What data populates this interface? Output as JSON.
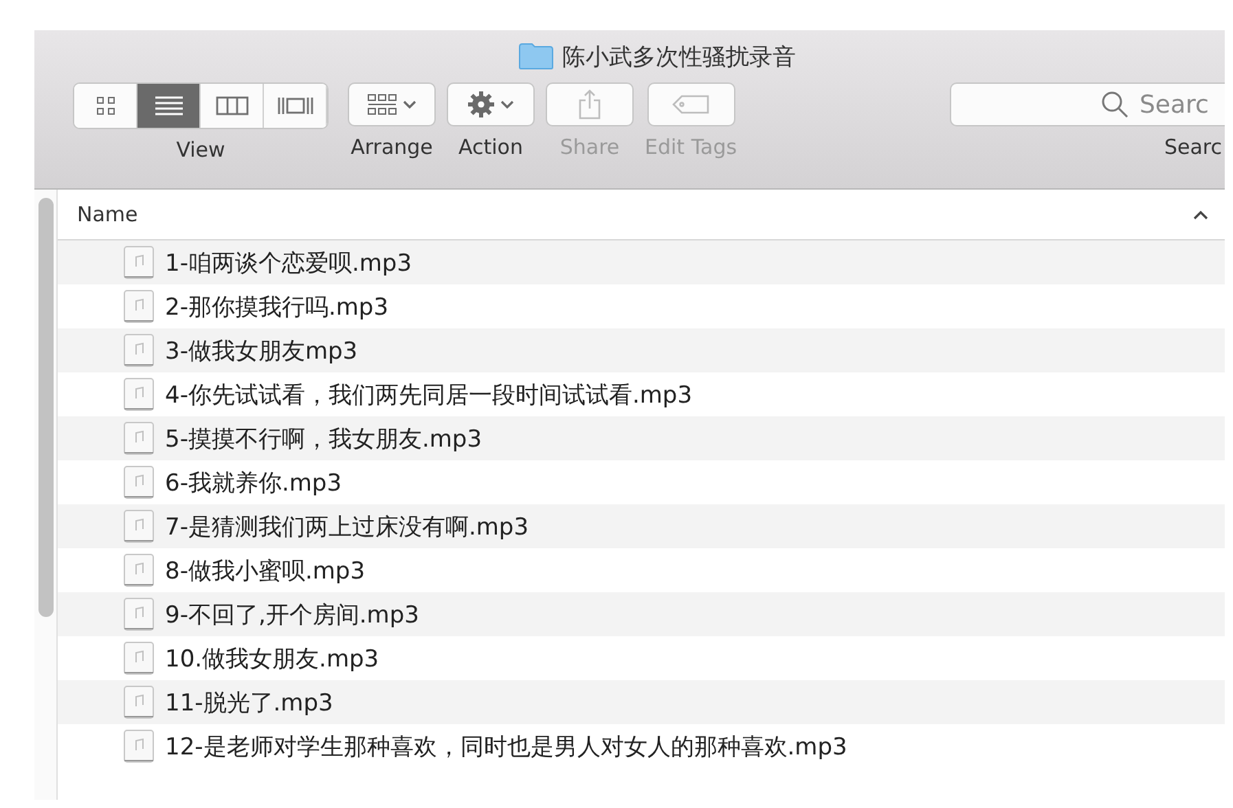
{
  "window": {
    "title": "陈小武多次性骚扰录音"
  },
  "toolbar": {
    "view_modes": [
      {
        "kind": "icon",
        "selected": false
      },
      {
        "kind": "list",
        "selected": true
      },
      {
        "kind": "columns",
        "selected": false
      },
      {
        "kind": "gallery",
        "selected": false
      }
    ],
    "view_label": "View",
    "items": [
      {
        "kind": "arrange",
        "label": "Arrange",
        "disabled": false
      },
      {
        "kind": "action",
        "label": "Action",
        "disabled": false
      },
      {
        "kind": "share",
        "label": "Share",
        "disabled": true
      },
      {
        "kind": "tags",
        "label": "Edit Tags",
        "disabled": true
      }
    ],
    "search": {
      "placeholder": "Searc",
      "label": "Searc"
    }
  },
  "list": {
    "header": "Name",
    "files": [
      {
        "name": "1-咱两谈个恋爱呗.mp3"
      },
      {
        "name": "2-那你摸我行吗.mp3"
      },
      {
        "name": "3-做我女朋友mp3"
      },
      {
        "name": "4-你先试试看，我们两先同居一段时间试试看.mp3"
      },
      {
        "name": "5-摸摸不行啊，我女朋友.mp3"
      },
      {
        "name": "6-我就养你.mp3"
      },
      {
        "name": "7-是猜测我们两上过床没有啊.mp3"
      },
      {
        "name": "8-做我小蜜呗.mp3"
      },
      {
        "name": "9-不回了,开个房间.mp3"
      },
      {
        "name": "10.做我女朋友.mp3"
      },
      {
        "name": "11-脱光了.mp3"
      },
      {
        "name": "12-是老师对学生那种喜欢，同时也是男人对女人的那种喜欢.mp3"
      }
    ]
  }
}
